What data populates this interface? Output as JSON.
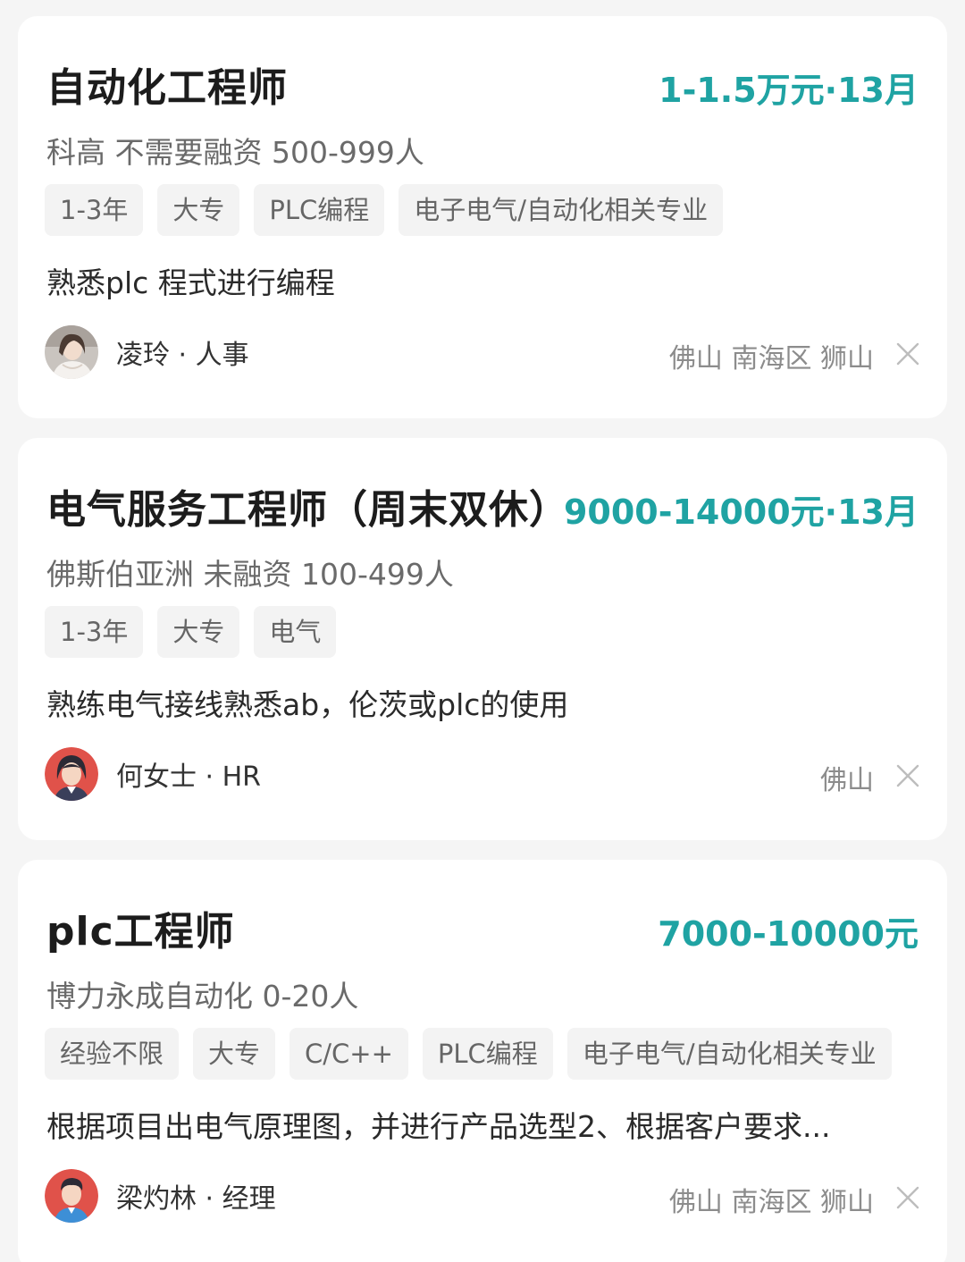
{
  "jobs": [
    {
      "title": "自动化工程师",
      "salary": "1-1.5万元·13月",
      "company": "科高 不需要融资 500-999人",
      "tags": [
        "1-3年",
        "大专",
        "PLC编程",
        "电子电气/自动化相关专业"
      ],
      "description": "熟悉plc 程式进行编程",
      "recruiter": "凌玲 · 人事",
      "location": "佛山 南海区 狮山"
    },
    {
      "title": "电气服务工程师（周末双休）",
      "salary": "9000-14000元·13月",
      "company": "佛斯伯亚洲 未融资 100-499人",
      "tags": [
        "1-3年",
        "大专",
        "电气"
      ],
      "description": "熟练电气接线熟悉ab，伦茨或plc的使用",
      "recruiter": "何女士 · HR",
      "location": "佛山"
    },
    {
      "title": "plc工程师",
      "salary": "7000-10000元",
      "company": "博力永成自动化 0-20人",
      "tags": [
        "经验不限",
        "大专",
        "C/C++",
        "PLC编程",
        "电子电气/自动化相关专业"
      ],
      "description": "根据项目出电气原理图，并进行产品选型2、根据客户要求...",
      "recruiter": "梁灼林 · 经理",
      "location": "佛山 南海区 狮山"
    }
  ],
  "colors": {
    "salary": "#1fa3a3",
    "background": "#f5f5f5"
  },
  "icons": {
    "dismiss": "close-icon"
  }
}
